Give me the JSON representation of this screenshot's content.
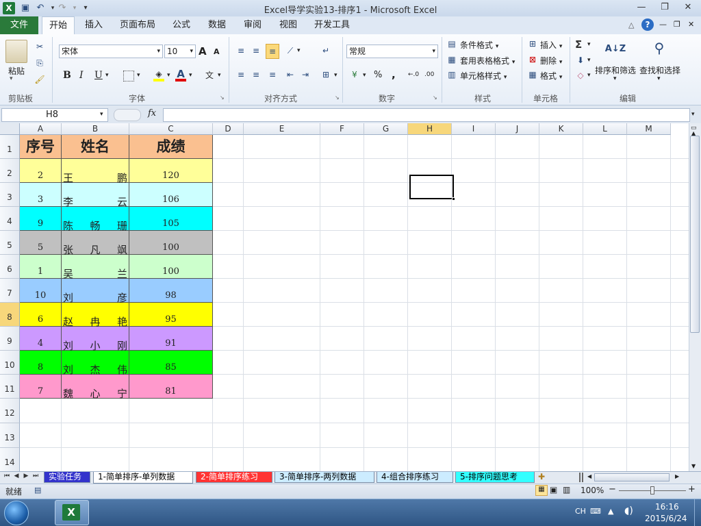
{
  "window": {
    "title": "Excel导学实验13-排序1  -  Microsoft Excel",
    "app_icon": "X",
    "qat_icons": [
      "save-icon",
      "undo-icon",
      "redo-icon",
      "customize-icon"
    ],
    "controls": [
      "minimize-icon",
      "restore-icon",
      "close-icon"
    ]
  },
  "ribbon": {
    "file_tab": "文件",
    "tabs": [
      "开始",
      "插入",
      "页面布局",
      "公式",
      "数据",
      "审阅",
      "视图",
      "开发工具"
    ],
    "active_tab": "开始",
    "groups": {
      "clipboard": {
        "label": "剪贴板",
        "paste": "粘贴"
      },
      "font": {
        "label": "字体",
        "font_name": "宋体",
        "font_size": "10",
        "bold": "B",
        "italic": "I",
        "underline": "U",
        "big_a": "A",
        "small_a": "A",
        "font_color": "A"
      },
      "alignment": {
        "label": "对齐方式"
      },
      "number": {
        "label": "数字",
        "format": "常规",
        "percent": "%",
        "comma": ",",
        "inc_decimal": "←.0 .00",
        "dec_decimal": ".00 →.0"
      },
      "styles": {
        "label": "样式",
        "conditional": "条件格式",
        "table": "套用表格格式",
        "cell_styles": "单元格样式"
      },
      "cells": {
        "label": "单元格",
        "insert": "插入",
        "delete": "删除",
        "format": "格式"
      },
      "editing": {
        "label": "编辑",
        "sigma": "Σ",
        "sort_filter": "排序和筛选",
        "find_select": "查找和选择"
      }
    }
  },
  "formula_bar": {
    "name_box": "H8",
    "fx": "fx",
    "formula": ""
  },
  "grid": {
    "columns": [
      "A",
      "B",
      "C",
      "D",
      "E",
      "F",
      "G",
      "H",
      "I",
      "J",
      "K",
      "L",
      "M"
    ],
    "rows": [
      "1",
      "2",
      "3",
      "4",
      "5",
      "6",
      "7",
      "8",
      "9",
      "10",
      "11",
      "12",
      "13",
      "14"
    ],
    "selected_cell": "H8",
    "header": [
      "序号",
      "姓名",
      "成绩"
    ],
    "data": [
      {
        "no": "2",
        "name": [
          "王",
          "鹏"
        ],
        "score": "120",
        "color": "#ffff99"
      },
      {
        "no": "3",
        "name": [
          "李",
          "云"
        ],
        "score": "106",
        "color": "#ccffff"
      },
      {
        "no": "9",
        "name": [
          "陈",
          "畅",
          "珊"
        ],
        "score": "105",
        "color": "#00ffff"
      },
      {
        "no": "5",
        "name": [
          "张",
          "凡",
          "飒"
        ],
        "score": "100",
        "color": "#c0c0c0"
      },
      {
        "no": "1",
        "name": [
          "吴",
          "兰"
        ],
        "score": "100",
        "color": "#ccffcc"
      },
      {
        "no": "10",
        "name": [
          "刘",
          "彦"
        ],
        "score": "98",
        "color": "#99ccff"
      },
      {
        "no": "6",
        "name": [
          "赵",
          "冉",
          "艳"
        ],
        "score": "95",
        "color": "#ffff00"
      },
      {
        "no": "4",
        "name": [
          "刘",
          "小",
          "刚"
        ],
        "score": "91",
        "color": "#cc99ff"
      },
      {
        "no": "8",
        "name": [
          "刘",
          "杰",
          "伟"
        ],
        "score": "85",
        "color": "#00ff00"
      },
      {
        "no": "7",
        "name": [
          "魏",
          "心",
          "宁"
        ],
        "score": "81",
        "color": "#ff99cc"
      }
    ],
    "header_color": "#fac090"
  },
  "sheets": [
    {
      "label": "实验任务",
      "bg": "#3333cc",
      "fg": "#ffffff"
    },
    {
      "label": "1-简单排序-单列数据",
      "bg": "#ffffff",
      "fg": "#000000"
    },
    {
      "label": "2-简单排序练习",
      "bg": "#ff3333",
      "fg": "#ffffff"
    },
    {
      "label": "3-简单排序-两列数据",
      "bg": "#ccecff",
      "fg": "#000000"
    },
    {
      "label": "4-组合排序练习",
      "bg": "#ccecff",
      "fg": "#000000"
    },
    {
      "label": "5-排序问题思考",
      "bg": "#33ffff",
      "fg": "#000000"
    }
  ],
  "status": {
    "ready": "就绪",
    "zoom": "100%",
    "minus": "−",
    "plus": "+"
  },
  "taskbar": {
    "lang": "CH",
    "time": "16:16",
    "date": "2015/6/24"
  }
}
